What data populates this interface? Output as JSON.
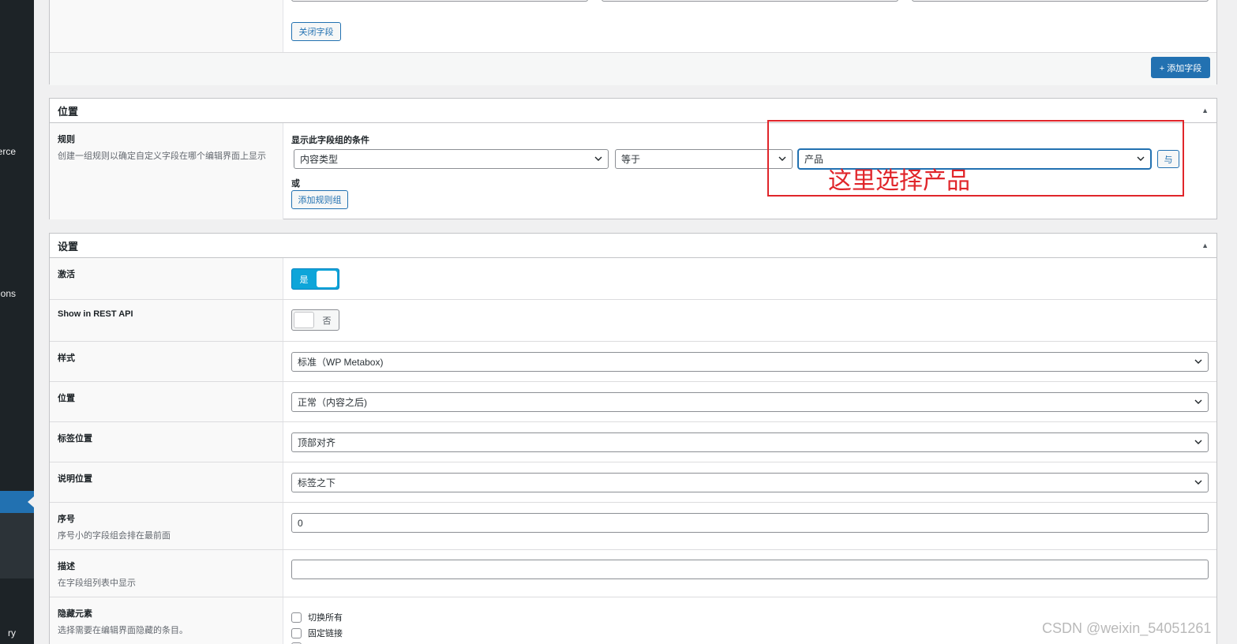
{
  "sidebar": {
    "items": [
      "erce",
      "ldons",
      "ry"
    ]
  },
  "fields_panel": {
    "close_field_label": "关闭字段",
    "add_field_label": "+ 添加字段"
  },
  "location_panel": {
    "title": "位置",
    "rules_label": "规则",
    "rules_desc": "创建一组规则以确定自定义字段在哪个编辑界面上显示",
    "condition_heading": "显示此字段组的条件",
    "param_value": "内容类型",
    "operator_value": "等于",
    "value_value": "产品",
    "and_label": "与",
    "or_label": "或",
    "add_rule_group_label": "添加规则组"
  },
  "annotation": {
    "text": "这里选择产品",
    "color": "#e0252a"
  },
  "settings_panel": {
    "title": "设置",
    "active": {
      "label": "激活",
      "switch_text": "是",
      "on": true
    },
    "rest_api": {
      "label": "Show in REST API",
      "switch_text": "否",
      "on": false
    },
    "style": {
      "label": "样式",
      "value": "标准（WP Metabox)"
    },
    "position": {
      "label": "位置",
      "value": "正常（内容之后)"
    },
    "label_placement": {
      "label": "标签位置",
      "value": "顶部对齐"
    },
    "instruction_placement": {
      "label": "说明位置",
      "value": "标签之下"
    },
    "order": {
      "label": "序号",
      "desc": "序号小的字段组会排在最前面",
      "value": "0"
    },
    "description": {
      "label": "描述",
      "desc": "在字段组列表中显示",
      "value": ""
    },
    "hide_on_screen": {
      "label": "隐藏元素",
      "desc": "选择需要在编辑界面隐藏的条目。",
      "options": [
        "切换所有",
        "固定链接"
      ]
    }
  },
  "watermark": "CSDN @weixin_54051261",
  "colors": {
    "accent": "#2271b1",
    "sidebar": "#1d2327",
    "switch_on": "#0ea5d9"
  }
}
